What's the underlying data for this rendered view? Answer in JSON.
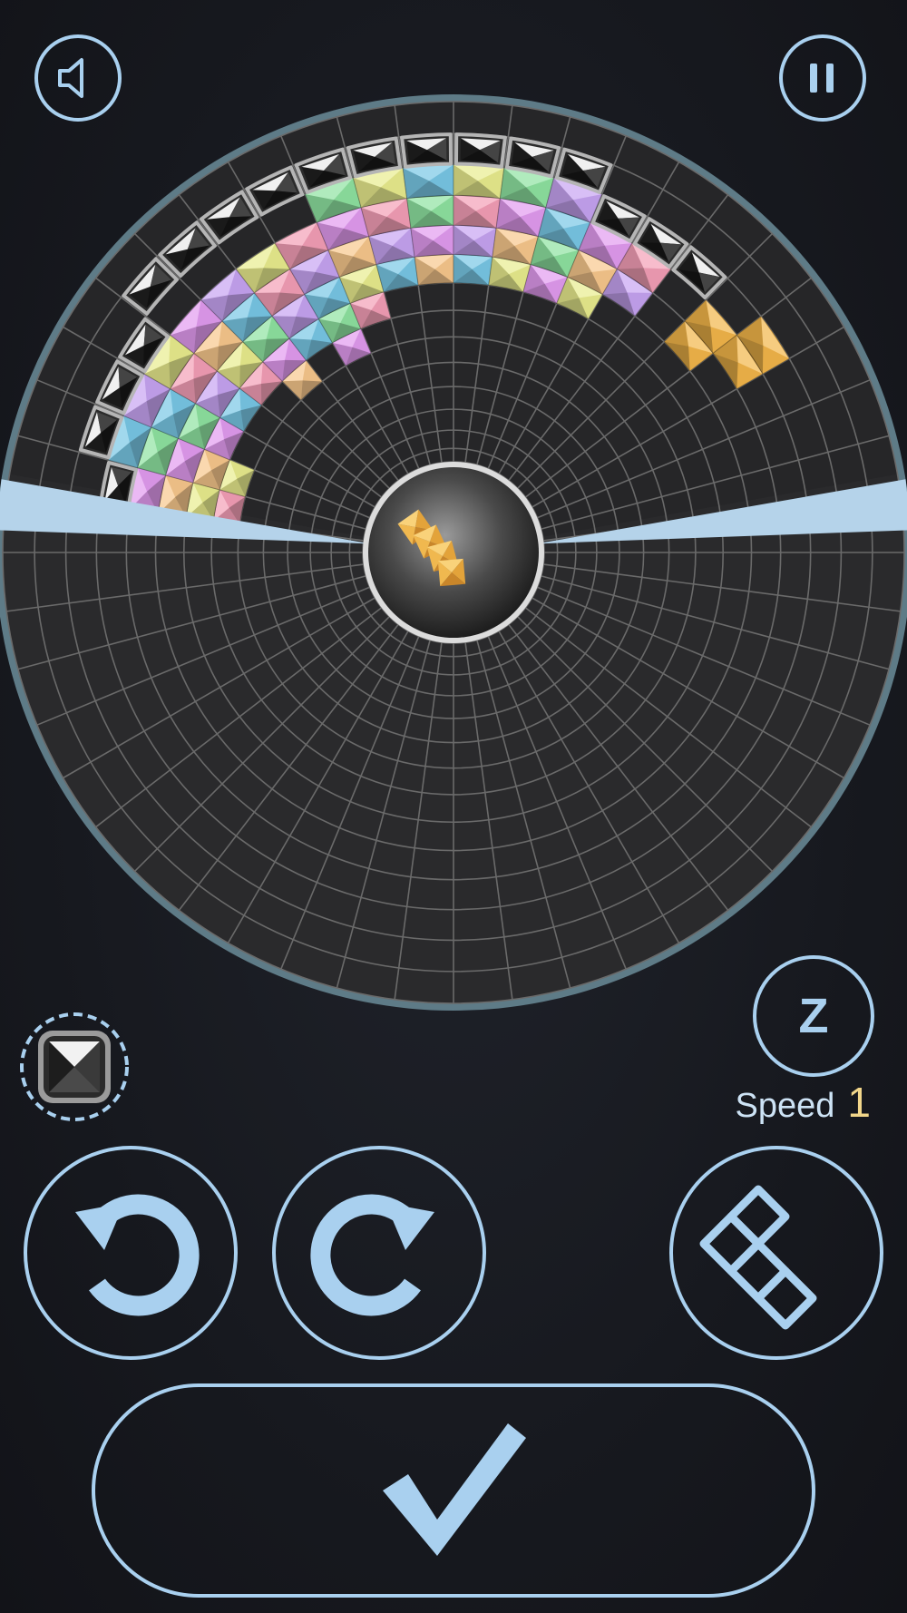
{
  "controls": {
    "sound_icon": "speaker-icon",
    "pause_icon": "pause-icon",
    "z_label": "Z",
    "speed_label": "Speed",
    "speed_value": "1",
    "rotate_left_icon": "rotate-ccw-icon",
    "rotate_right_icon": "rotate-cw-icon",
    "piece_icon": "piece-outline-icon",
    "confirm_icon": "checkmark-icon"
  },
  "colors": {
    "accent": "#a9d0ef",
    "speed_value": "#f2d68a",
    "board_bg": "#2a2a2c",
    "grid_line": "#6a6a6a",
    "active_piece": "#f3b64a",
    "gem_green": "#8fe3a1",
    "gem_blue": "#79c8e6",
    "gem_purple": "#c7a4f2",
    "gem_pink": "#f49fb7",
    "gem_yellow": "#e9ec8e",
    "gem_peach": "#f8c88d",
    "gem_magenta": "#e29bf0",
    "blocker_dark": "#3a3a3a"
  },
  "board": {
    "sectors": 48,
    "rings": 14,
    "current_piece": "orange-bar"
  }
}
